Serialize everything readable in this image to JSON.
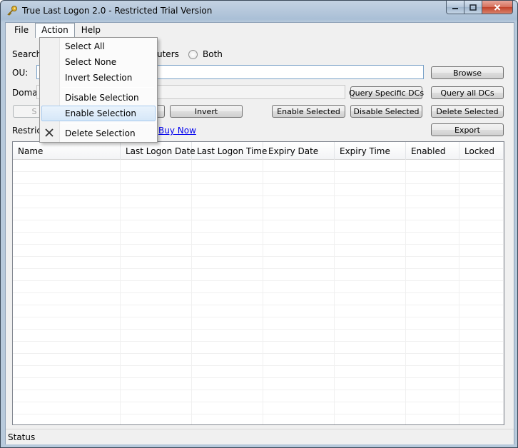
{
  "window": {
    "title": "True Last Logon 2.0 - Restricted Trial Version"
  },
  "menu": {
    "items": [
      "File",
      "Action",
      "Help"
    ]
  },
  "action_menu": {
    "items": [
      "Select All",
      "Select None",
      "Invert Selection",
      "Disable Selection",
      "Enable Selection",
      "Delete Selection"
    ],
    "highlighted": "Enable Selection"
  },
  "form": {
    "search_label": "Search",
    "computers_label_fragment": "uters",
    "both_label": "Both",
    "ou_label": "OU:",
    "domain_label": "Domain",
    "restricted_label_fragment": "Restrict",
    "buy_now": "Buy Now"
  },
  "buttons": {
    "browse": "Browse",
    "query_specific": "Query Specific DCs",
    "query_all": "Query all DCs",
    "select_fragment": "S",
    "invert": "Invert",
    "enable_selected": "Enable Selected",
    "disable_selected": "Disable Selected",
    "delete_selected": "Delete Selected",
    "export": "Export"
  },
  "table": {
    "columns": [
      "Name",
      "Last Logon Date",
      "Last Logon Time",
      "Expiry Date",
      "Expiry Time",
      "Enabled",
      "Locked"
    ]
  },
  "status": {
    "text": "Status"
  }
}
